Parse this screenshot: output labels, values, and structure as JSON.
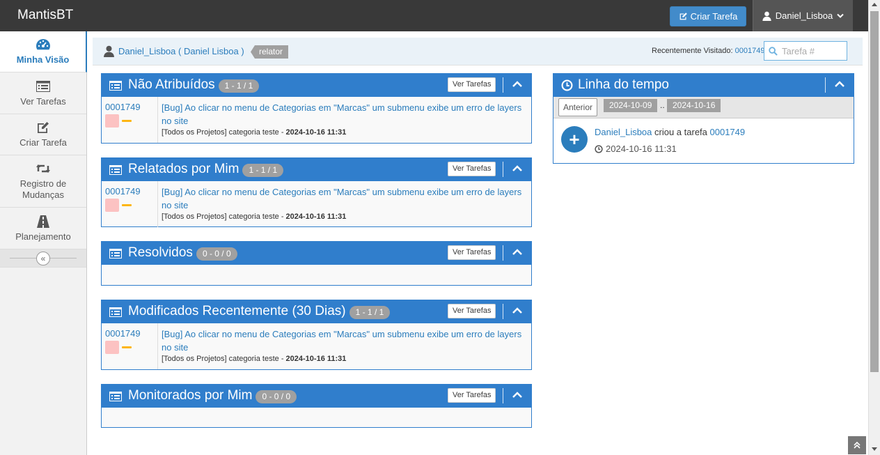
{
  "navbar": {
    "brand": "MantisBT",
    "create_label": "Criar Tarefa",
    "user_label": "Daniel_Lisboa"
  },
  "sidebar": {
    "items": [
      {
        "label": "Minha Visão",
        "icon": "dashboard-icon"
      },
      {
        "label": "Ver Tarefas",
        "icon": "list-icon"
      },
      {
        "label": "Criar Tarefa",
        "icon": "edit-icon"
      },
      {
        "label": "Registro de Mudanças",
        "icon": "retweet-icon"
      },
      {
        "label": "Planejamento",
        "icon": "road-icon"
      }
    ],
    "collapse_icon": "«"
  },
  "breadcrumb": {
    "user": "Daniel_Lisboa ( Daniel Lisboa )",
    "role": "relator",
    "recent_label": "Recentemente Visitado:",
    "recent_id": "0001749",
    "search_placeholder": "Tarefa #"
  },
  "widgets": [
    {
      "title": "Não Atribuídos",
      "badge": "1 - 1 / 1",
      "button": "Ver Tarefas",
      "rows": [
        {
          "id": "0001749",
          "summary": "[Bug] Ao clicar no menu de Categorias em \"Marcas\" um submenu exibe um erro de layers no site",
          "project": "[Todos os Projetos] categoria teste - ",
          "date": "2024-10-16 11:31"
        }
      ]
    },
    {
      "title": "Relatados por Mim",
      "badge": "1 - 1 / 1",
      "button": "Ver Tarefas",
      "rows": [
        {
          "id": "0001749",
          "summary": "[Bug] Ao clicar no menu de Categorias em \"Marcas\" um submenu exibe um erro de layers no site",
          "project": "[Todos os Projetos] categoria teste - ",
          "date": "2024-10-16 11:31"
        }
      ]
    },
    {
      "title": "Resolvidos",
      "badge": "0 - 0 / 0",
      "button": "Ver Tarefas",
      "rows": []
    },
    {
      "title": "Modificados Recentemente (30 Dias)",
      "badge": "1 - 1 / 1",
      "button": "Ver Tarefas",
      "rows": [
        {
          "id": "0001749",
          "summary": "[Bug] Ao clicar no menu de Categorias em \"Marcas\" um submenu exibe um erro de layers no site",
          "project": "[Todos os Projetos] categoria teste - ",
          "date": "2024-10-16 11:31"
        }
      ]
    },
    {
      "title": "Monitorados por Mim",
      "badge": "0 - 0 / 0",
      "button": "Ver Tarefas",
      "rows": []
    }
  ],
  "timeline": {
    "title": "Linha do tempo",
    "prev_label": "Anterior",
    "date_from": "2024-10-09",
    "sep": "..",
    "date_to": "2024-10-16",
    "entry": {
      "user": "Daniel_Lisboa",
      "action": " criou a tarefa ",
      "issue": "0001749",
      "time": "2024-10-16 11:31"
    }
  },
  "colors": {
    "primary": "#307ecc",
    "link": "#2b7dbc",
    "navbar": "#393939",
    "severity": "#fcc2c2",
    "priority": "#fdb614"
  }
}
